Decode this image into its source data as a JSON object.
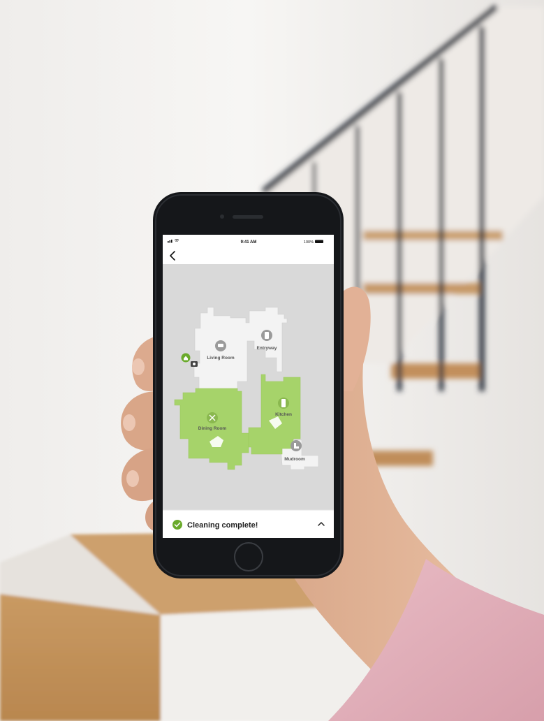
{
  "status_bar": {
    "time": "9:41 AM",
    "battery": "100%"
  },
  "nav": {
    "back_icon": "chevron-left-icon"
  },
  "map": {
    "rooms": [
      {
        "label": "Living Room",
        "state": "not-cleaned",
        "icon": "sofa-icon"
      },
      {
        "label": "Entryway",
        "state": "not-cleaned",
        "icon": "door-icon"
      },
      {
        "label": "Dining Room",
        "state": "cleaned",
        "icon": "utensils-icon"
      },
      {
        "label": "Kitchen",
        "state": "cleaned",
        "icon": "fridge-icon"
      },
      {
        "label": "Mudroom",
        "state": "not-cleaned",
        "icon": "boot-icon"
      }
    ],
    "colors": {
      "cleaned": "#a6d36a",
      "uncleaned": "#f4f4f4",
      "background": "#d9d9d9",
      "accent": "#6aaa2b"
    }
  },
  "bottom_sheet": {
    "status": "Cleaning complete!",
    "status_icon": "check-circle-icon",
    "expand_icon": "chevron-up-icon"
  }
}
